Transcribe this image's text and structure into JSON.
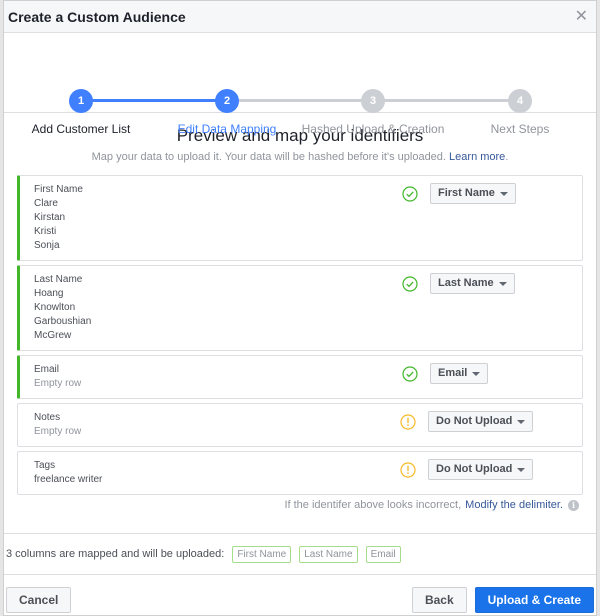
{
  "dialog": {
    "title": "Create a Custom Audience",
    "close_icon": "close-icon"
  },
  "colors": {
    "active": "#4080ff",
    "inactive": "#ccd0d5",
    "mapped": "#42b72a",
    "warning": "#f7b928",
    "link": "#365899",
    "primary_button": "#1a73e8"
  },
  "stepper": {
    "current_step": 2,
    "steps": [
      {
        "number": "1",
        "label": "Add Customer List",
        "state": "complete"
      },
      {
        "number": "2",
        "label": "Edit Data Mapping",
        "state": "current"
      },
      {
        "number": "3",
        "label": "Hashed Upload & Creation",
        "state": "pending"
      },
      {
        "number": "4",
        "label": "Next Steps",
        "state": "pending"
      }
    ]
  },
  "intro": {
    "title": "Preview and map your identifiers",
    "subtitle": "Map your data to upload it. Your data will be hashed before it's uploaded.",
    "learn_more": "Learn more",
    "period": "."
  },
  "rows": [
    {
      "column": "First Name",
      "values": [
        "Clare",
        "Kirstan",
        "Kristi",
        "Sonja"
      ],
      "empty": false,
      "status": "check-circle-icon",
      "mapping": "First Name",
      "mapped": true
    },
    {
      "column": "Last Name",
      "values": [
        "Hoang",
        "Knowlton",
        "Garboushian",
        "McGrew"
      ],
      "empty": false,
      "status": "check-circle-icon",
      "mapping": "Last Name",
      "mapped": true
    },
    {
      "column": "Email",
      "values": [
        "Empty row"
      ],
      "empty": true,
      "status": "check-circle-icon",
      "mapping": "Email",
      "mapped": true
    },
    {
      "column": "Notes",
      "values": [
        "Empty row"
      ],
      "empty": true,
      "status": "warning-circle-icon",
      "mapping": "Do Not Upload",
      "mapped": false
    },
    {
      "column": "Tags",
      "values": [
        "freelance writer"
      ],
      "empty": false,
      "status": "warning-circle-icon",
      "mapping": "Do Not Upload",
      "mapped": false
    }
  ],
  "delimiter": {
    "text": "If the identifer above looks incorrect,",
    "link": "Modify the delimiter.",
    "info_icon": "i"
  },
  "summary": {
    "text": "3 columns are mapped and will be uploaded:",
    "chips": [
      "First Name",
      "Last Name",
      "Email"
    ]
  },
  "footer": {
    "cancel": "Cancel",
    "back": "Back",
    "upload": "Upload & Create"
  }
}
